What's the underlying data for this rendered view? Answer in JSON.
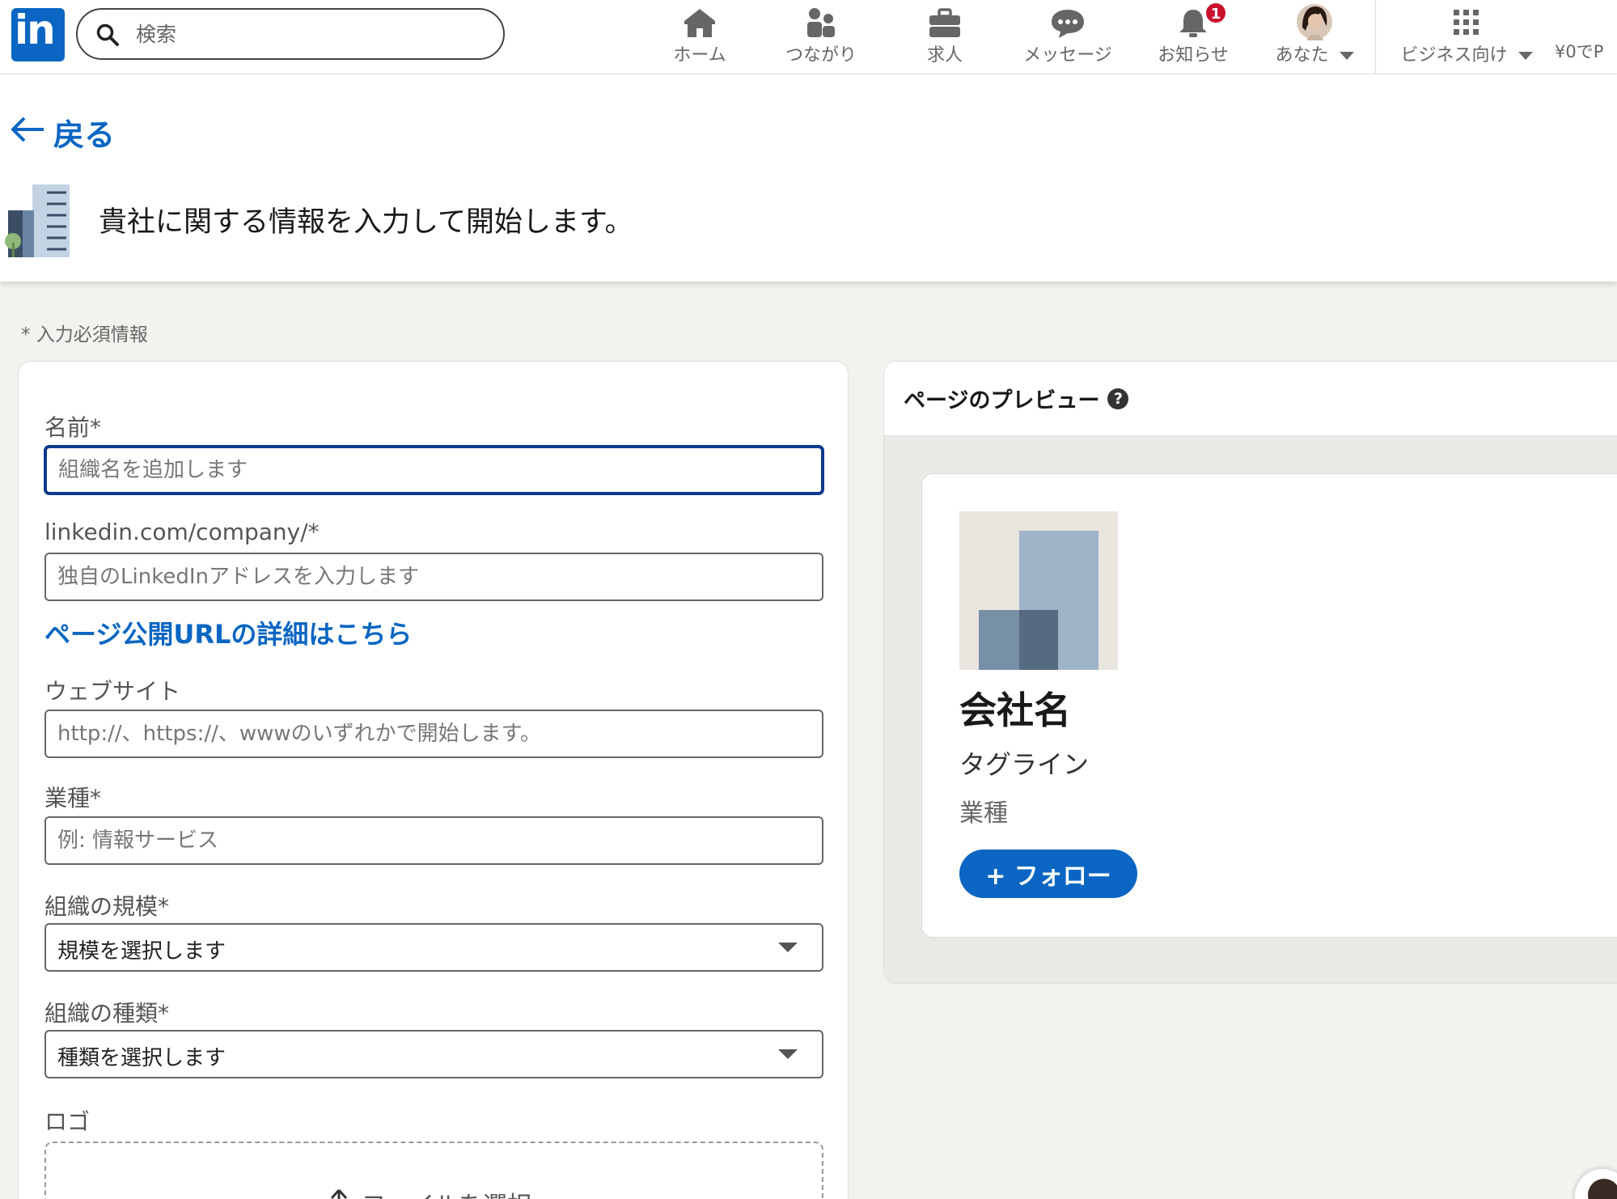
{
  "nav": {
    "logo_text": "in",
    "search_placeholder": "検索",
    "items": [
      {
        "label": "ホーム",
        "icon": "home-icon"
      },
      {
        "label": "つながり",
        "icon": "network-icon"
      },
      {
        "label": "求人",
        "icon": "jobs-icon"
      },
      {
        "label": "メッセージ",
        "icon": "messaging-icon"
      },
      {
        "label": "お知らせ",
        "icon": "notifications-icon",
        "badge": "1"
      },
      {
        "label": "あなた",
        "icon": "avatar"
      },
      {
        "label": "ビジネス向け",
        "icon": "grid-icon"
      }
    ],
    "premium": "¥0でP"
  },
  "header": {
    "back": "戻る",
    "title": "貴社に関する情報を入力して開始します。"
  },
  "form": {
    "required_note": "* 入力必須情報",
    "name_label": "名前*",
    "name_placeholder": "組織名を追加します",
    "url_label": "linkedin.com/company/*",
    "url_placeholder": "独自のLinkedInアドレスを入力します",
    "url_link": "ページ公開URLの詳細はこちら",
    "website_label": "ウェブサイト",
    "website_placeholder": "http://、https://、wwwのいずれかで開始します。",
    "industry_label": "業種*",
    "industry_placeholder": "例: 情報サービス",
    "size_label": "組織の規模*",
    "size_value": "規模を選択します",
    "type_label": "組織の種類*",
    "type_value": "種類を選択します",
    "logo_label": "ロゴ",
    "upload_text": "ファイルを選択"
  },
  "preview": {
    "title": "ページのプレビュー",
    "help": "?",
    "company_name": "会社名",
    "tagline": "タグライン",
    "industry": "業種",
    "follow": "+ フォロー"
  },
  "colors": {
    "brand": "#0a66c2",
    "badge": "#cb112d",
    "background": "#f3f2ef"
  }
}
